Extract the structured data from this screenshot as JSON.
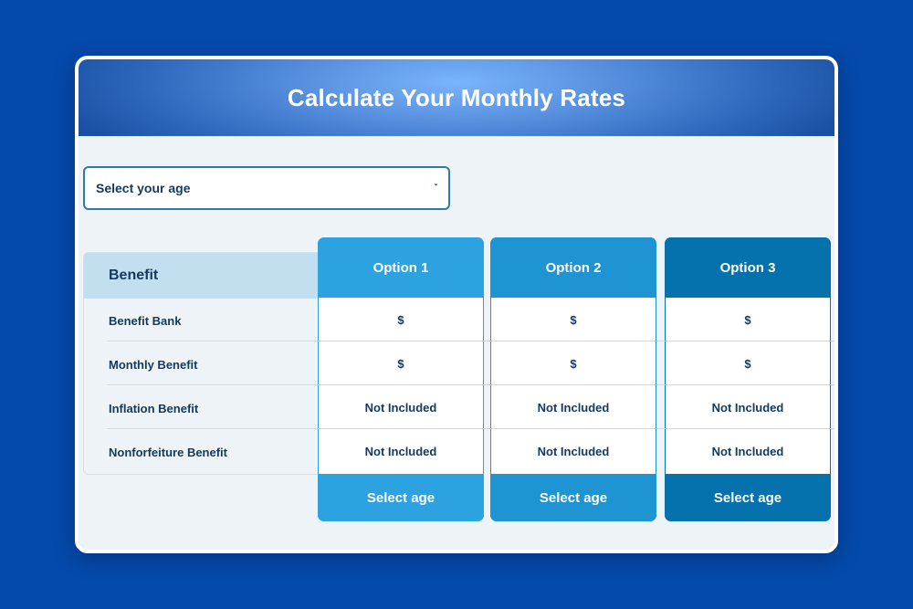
{
  "header": {
    "title": "Calculate Your Monthly Rates"
  },
  "age_select": {
    "value": "Select your age",
    "icon": "chevron-down-icon"
  },
  "benefits": {
    "header": "Benefit",
    "rows": [
      "Benefit Bank",
      "Monthly Benefit",
      "Inflation Benefit",
      "Nonforfeiture Benefit"
    ]
  },
  "options": [
    {
      "label": "Option 1",
      "color": "#2ca3e0",
      "values": [
        "$",
        "$",
        "Not Included",
        "Not Included"
      ],
      "button": "Select age"
    },
    {
      "label": "Option 2",
      "color": "#1e94d2",
      "values": [
        "$",
        "$",
        "Not Included",
        "Not Included"
      ],
      "button": "Select age"
    },
    {
      "label": "Option 3",
      "color": "#0672ad",
      "values": [
        "$",
        "$",
        "Not Included",
        "Not Included"
      ],
      "button": "Select age"
    }
  ]
}
